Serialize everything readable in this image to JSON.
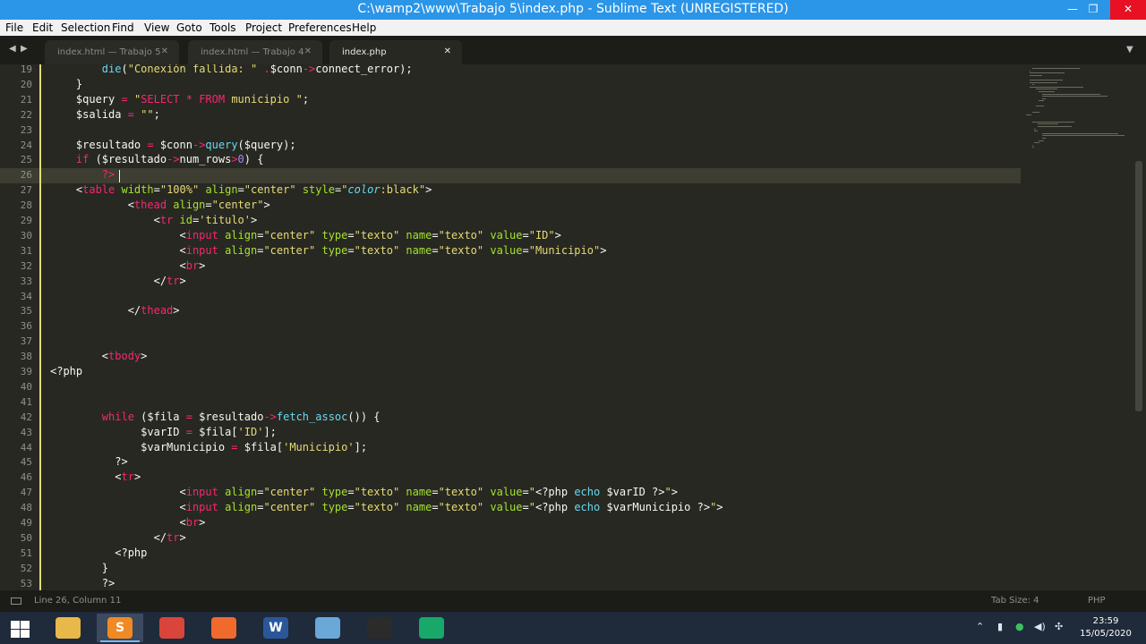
{
  "window": {
    "title": "C:\\wamp2\\www\\Trabajo 5\\index.php - Sublime Text (UNREGISTERED)"
  },
  "menu": [
    "File",
    "Edit",
    "Selection",
    "Find",
    "View",
    "Goto",
    "Tools",
    "Project",
    "Preferences",
    "Help"
  ],
  "tabs": [
    {
      "label": "index.html — Trabajo 5",
      "active": false
    },
    {
      "label": "index.html — Trabajo 4",
      "active": false
    },
    {
      "label": "index.php",
      "active": true
    }
  ],
  "editor": {
    "current_line": 26,
    "lines": [
      {
        "n": "19",
        "html": "        <span class='f'>die</span>(<span class='s'>\"Conexión fallida: \"</span> <span class='k'>.</span>$conn<span class='k'>-></span>connect_error);"
      },
      {
        "n": "20",
        "html": "    }"
      },
      {
        "n": "21",
        "html": "    $query <span class='k'>=</span> <span class='s'>\"</span><span class='k'>SELECT * FROM</span><span class='s'> municipio \"</span>;"
      },
      {
        "n": "22",
        "html": "    $salida <span class='k'>=</span> <span class='s'>\"\"</span>;"
      },
      {
        "n": "23",
        "html": ""
      },
      {
        "n": "24",
        "html": "    $resultado <span class='k'>=</span> $conn<span class='k'>-></span><span class='f'>query</span>($query);"
      },
      {
        "n": "25",
        "html": "    <span class='k'>if</span> ($resultado<span class='k'>-></span>num_rows<span class='k'>></span><span class='n'>0</span>) {"
      },
      {
        "n": "26",
        "html": "        <span class='k'>?></span>"
      },
      {
        "n": "27",
        "html": "    &lt;<span class='k'>table</span> <span class='a'>width</span>=<span class='s'>\"100%\"</span> <span class='a'>align</span>=<span class='s'>\"center\"</span> <span class='a'>style</span>=<span class='s'>\"</span><span class='i'>color</span><span class='s'>:black\"</span>&gt;"
      },
      {
        "n": "28",
        "html": "            &lt;<span class='k'>thead</span> <span class='a'>align</span>=<span class='s'>\"center\"</span>&gt;"
      },
      {
        "n": "29",
        "html": "                &lt;<span class='k'>tr</span> <span class='a'>id</span>=<span class='s'>'titulo'</span>&gt;"
      },
      {
        "n": "30",
        "html": "                    &lt;<span class='k'>input</span> <span class='a'>align</span>=<span class='s'>\"center\"</span> <span class='a'>type</span>=<span class='s'>\"texto\"</span> <span class='a'>name</span>=<span class='s'>\"texto\"</span> <span class='a'>value</span>=<span class='s'>\"ID\"</span>&gt;"
      },
      {
        "n": "31",
        "html": "                    &lt;<span class='k'>input</span> <span class='a'>align</span>=<span class='s'>\"center\"</span> <span class='a'>type</span>=<span class='s'>\"texto\"</span> <span class='a'>name</span>=<span class='s'>\"texto\"</span> <span class='a'>value</span>=<span class='s'>\"Municipio\"</span>&gt;"
      },
      {
        "n": "32",
        "html": "                    &lt;<span class='k'>br</span>&gt;"
      },
      {
        "n": "33",
        "html": "                &lt;/<span class='k'>tr</span>&gt;"
      },
      {
        "n": "34",
        "html": ""
      },
      {
        "n": "35",
        "html": "            &lt;/<span class='k'>thead</span>&gt;"
      },
      {
        "n": "36",
        "html": ""
      },
      {
        "n": "37",
        "html": ""
      },
      {
        "n": "38",
        "html": "        &lt;<span class='k'>tbody</span>&gt;"
      },
      {
        "n": "39",
        "html": "&lt;?php"
      },
      {
        "n": "40",
        "html": ""
      },
      {
        "n": "41",
        "html": ""
      },
      {
        "n": "42",
        "html": "        <span class='k'>while</span> ($fila <span class='k'>=</span> $resultado<span class='k'>-></span><span class='f'>fetch_assoc</span>()) {"
      },
      {
        "n": "43",
        "html": "              $varID <span class='k'>=</span> $fila[<span class='s'>'ID'</span>];"
      },
      {
        "n": "44",
        "html": "              $varMunicipio <span class='k'>=</span> $fila[<span class='s'>'Municipio'</span>];"
      },
      {
        "n": "45",
        "html": "          ?>"
      },
      {
        "n": "46",
        "html": "          &lt;<span class='k'>tr</span>&gt;"
      },
      {
        "n": "47",
        "html": "                    &lt;<span class='k'>input</span> <span class='a'>align</span>=<span class='s'>\"center\"</span> <span class='a'>type</span>=<span class='s'>\"texto\"</span> <span class='a'>name</span>=<span class='s'>\"texto\"</span> <span class='a'>value</span>=<span class='s'>\"</span>&lt;?php <span class='f'>echo</span> $varID ?&gt;<span class='s'>\"</span>&gt;"
      },
      {
        "n": "48",
        "html": "                    &lt;<span class='k'>input</span> <span class='a'>align</span>=<span class='s'>\"center\"</span> <span class='a'>type</span>=<span class='s'>\"texto\"</span> <span class='a'>name</span>=<span class='s'>\"texto\"</span> <span class='a'>value</span>=<span class='s'>\"</span>&lt;?php <span class='f'>echo</span> $varMunicipio ?&gt;<span class='s'>\"</span>&gt;"
      },
      {
        "n": "49",
        "html": "                    &lt;<span class='k'>br</span>&gt;"
      },
      {
        "n": "50",
        "html": "                &lt;/<span class='k'>tr</span>&gt;"
      },
      {
        "n": "51",
        "html": "          &lt;?php"
      },
      {
        "n": "52",
        "html": "        }"
      },
      {
        "n": "53",
        "html": "        ?>"
      }
    ]
  },
  "status": {
    "position": "Line 26, Column 11",
    "tab_size": "Tab Size: 4",
    "syntax": "PHP"
  },
  "taskbar": {
    "apps": [
      {
        "name": "file-explorer",
        "color": "#e8b84a",
        "glyph": "",
        "active": false
      },
      {
        "name": "sublime-text",
        "color": "#f08a24",
        "glyph": "S",
        "active": true
      },
      {
        "name": "chrome",
        "color": "#d9453b",
        "glyph": "",
        "active": false
      },
      {
        "name": "firefox",
        "color": "#f06a2c",
        "glyph": "",
        "active": false
      },
      {
        "name": "word",
        "color": "#2b579a",
        "glyph": "W",
        "active": false
      },
      {
        "name": "paint",
        "color": "#6aa8d8",
        "glyph": "",
        "active": false
      },
      {
        "name": "obs",
        "color": "#2b2b2b",
        "glyph": "",
        "active": false
      },
      {
        "name": "app-launcher",
        "color": "#18a86a",
        "glyph": "",
        "active": false
      }
    ],
    "time": "23:59",
    "date": "15/05/2020"
  },
  "colors": {
    "titlebar": "#2b95e8",
    "editor_bg": "#272822",
    "keyword": "#f92672",
    "string": "#e6db74",
    "function": "#66d9ef",
    "attribute": "#a6e22e"
  }
}
